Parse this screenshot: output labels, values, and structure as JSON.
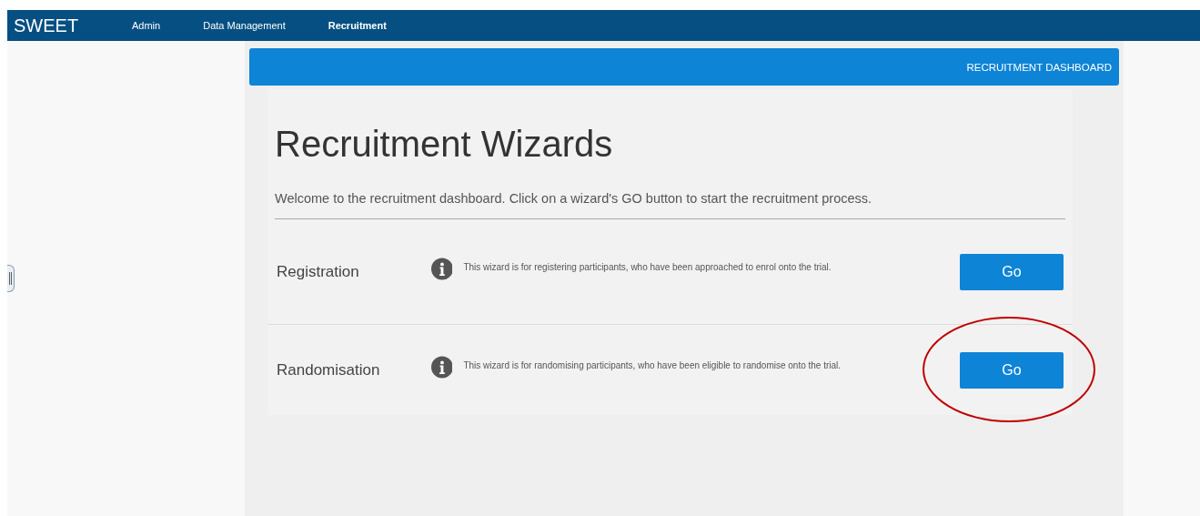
{
  "nav": {
    "brand": "SWEET",
    "items": [
      {
        "label": "Admin",
        "selected": false
      },
      {
        "label": "Data Management",
        "selected": false
      },
      {
        "label": "Recruitment",
        "selected": true
      }
    ]
  },
  "banner": {
    "title": "RECRUITMENT DASHBOARD"
  },
  "heading": "Recruitment Wizards",
  "intro": "Welcome to the recruitment dashboard. Click on a wizard's GO button to start the recruitment process.",
  "wizards": [
    {
      "name": "Registration",
      "description": "This wizard is for registering participants, who have been approached to enrol onto the trial.",
      "button": "Go",
      "circled": false
    },
    {
      "name": "Randomisation",
      "description": "This wizard is for randomising participants, who have been eligible to randomise onto the trial.",
      "button": "Go",
      "circled": true
    }
  ]
}
